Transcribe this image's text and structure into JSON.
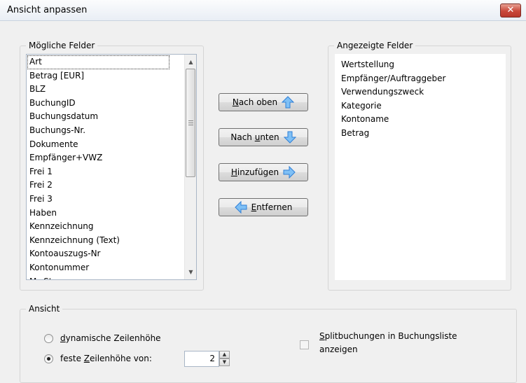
{
  "window": {
    "title": "Ansicht anpassen",
    "close_symbol": "✕"
  },
  "possible_fields": {
    "legend": "Mögliche Felder",
    "items": [
      "Art",
      "Betrag [EUR]",
      "BLZ",
      "BuchungID",
      "Buchungsdatum",
      "Buchungs-Nr.",
      "Dokumente",
      "Empfänger+VWZ",
      "Frei 1",
      "Frei 2",
      "Frei 3",
      "Haben",
      "Kennzeichnung",
      "Kennzeichnung (Text)",
      "Kontoauszugs-Nr",
      "Kontonummer",
      "MwSt"
    ]
  },
  "displayed_fields": {
    "legend": "Angezeigte Felder",
    "items": [
      "Wertstellung",
      "Empfänger/Auftraggeber",
      "Verwendungszweck",
      "Kategorie",
      "Kontoname",
      "Betrag"
    ]
  },
  "buttons": {
    "up": {
      "pre": "",
      "key": "N",
      "post": "ach oben"
    },
    "down": {
      "pre": "Nach ",
      "key": "u",
      "post": "nten"
    },
    "add": {
      "pre": "",
      "key": "H",
      "post": "inzufügen"
    },
    "remove": {
      "pre": "",
      "key": "E",
      "post": "ntfernen"
    }
  },
  "view": {
    "legend": "Ansicht",
    "dynamic": {
      "pre": "",
      "key": "d",
      "post": "ynamische Zeilenhöhe"
    },
    "fixed": {
      "pre": "feste ",
      "key": "Z",
      "post": "eilenhöhe von:"
    },
    "row_height_value": "2",
    "split_line1": {
      "pre": "",
      "key": "S",
      "post": "plitbuchungen in Buchungsliste"
    },
    "split_line2": "anzeigen"
  },
  "colors": {
    "arrow_blue": "#2f7fd6",
    "arrow_blue_light": "#7fc0f5"
  }
}
